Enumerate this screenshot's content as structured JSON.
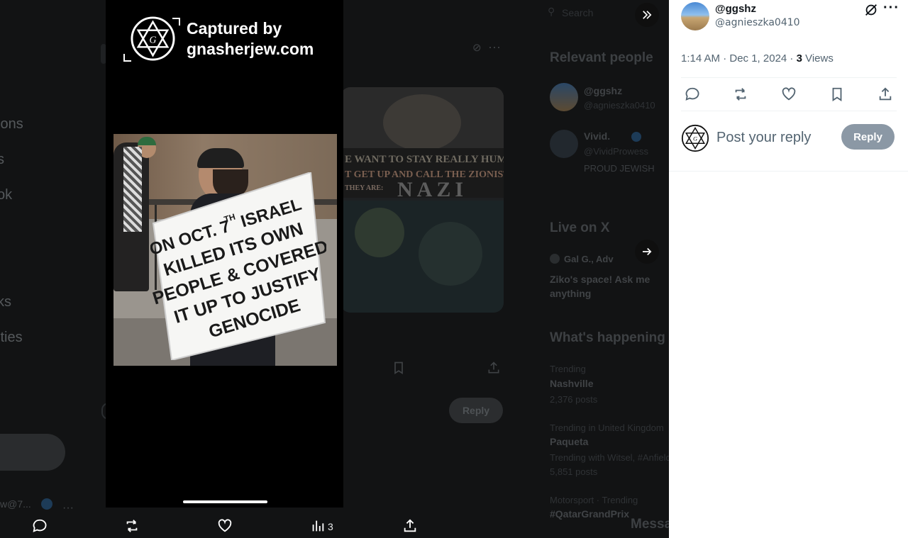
{
  "background": {
    "nav_fragments": [
      "ions",
      "s",
      "ok",
      "ks",
      "ities"
    ],
    "search_placeholder": "Search",
    "relevant_people_title": "Relevant people",
    "people": [
      {
        "name": "@ggshz",
        "handle": "@agnieszka0410"
      },
      {
        "name": "Vivid.",
        "handle": "@VividProwess",
        "bio": "PROUD JEWISH"
      }
    ],
    "live_title": "Live on X",
    "live_host": "Gal G., Adv",
    "live_space_title": "Ziko's space! Ask me anything",
    "whats_happening_title": "What's happening",
    "trends": [
      {
        "context": "Trending",
        "name": "Nashville",
        "count": "2,376 posts"
      },
      {
        "context": "Trending in United Kingdom",
        "name": "Paqueta",
        "count": "Trending with Witsel, #Anfield",
        "extra": "5,851 posts"
      },
      {
        "context": "Motorsport · Trending",
        "name": "#QatarGrandPrix",
        "count": ""
      }
    ],
    "messages_label": "Messages",
    "reply_label": "Reply",
    "user_handle_fragment": "w@7..."
  },
  "media": {
    "capture_line1": "Captured by",
    "capture_line2": "gnasherjew.com",
    "sign_lines": [
      "ON OCT. 7",
      "ISRAEL",
      "KILLED ITS OWN",
      "PEOPLE & COVERED",
      "IT UP TO JUSTIFY",
      "GENOCIDE"
    ],
    "sign_superscript": "TH",
    "bg_banner_line1": "E WANT TO STAY REALLY HUMAN BEINGS,",
    "bg_banner_line2": "T GET UP AND CALL THE ZIONISTS",
    "bg_banner_line3": "THEY ARE:",
    "bg_banner_big": "NAZI"
  },
  "bottom_bar": {
    "views_count": "3"
  },
  "tweet": {
    "display_name": "@ggshz",
    "handle": "@agnieszka0410",
    "time": "1:14 AM · Dec 1, 2024 · ",
    "views_number": "3",
    "views_label": " Views",
    "reply_placeholder": "Post your reply",
    "reply_button": "Reply"
  },
  "colors": {
    "reply_button_bg": "#8b98a5",
    "panel_bg": "#ffffff",
    "overlay_bg": "#000000",
    "secondary_text": "#536471"
  },
  "icons": [
    "collapse-panel-icon",
    "next-arrow-icon",
    "grok-icon",
    "more-icon",
    "reply-icon",
    "repost-icon",
    "like-icon",
    "bookmark-icon",
    "share-icon",
    "views-icon",
    "gnasherjew-logo"
  ]
}
